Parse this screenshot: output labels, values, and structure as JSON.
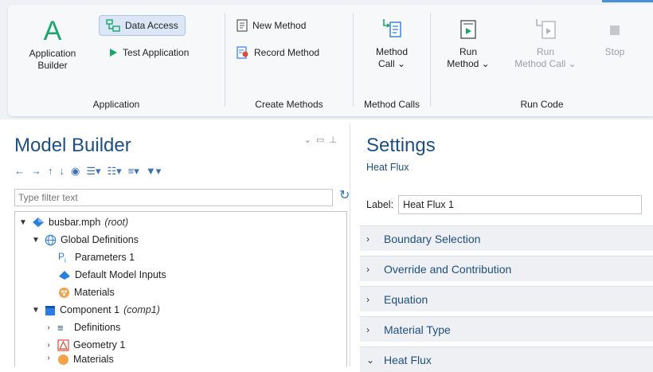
{
  "ribbon": {
    "groups": {
      "application": {
        "label": "Application",
        "app_builder": "Application\nBuilder",
        "data_access": "Data Access",
        "test_application": "Test Application"
      },
      "create_methods": {
        "label": "Create Methods",
        "new_method": "New Method",
        "record_method": "Record Method"
      },
      "method_calls": {
        "label": "Method Calls",
        "method_call": "Method\nCall ⌄"
      },
      "run_code": {
        "label": "Run Code",
        "run_method": "Run\nMethod ⌄",
        "run_method_call": "Run\nMethod Call ⌄",
        "stop": "Stop"
      }
    }
  },
  "model_builder": {
    "title": "Model Builder",
    "filter_placeholder": "Type filter text",
    "tree": {
      "root": {
        "name": "busbar.mph",
        "note": "(root)"
      },
      "global_definitions": "Global Definitions",
      "parameters": "Parameters 1",
      "default_inputs": "Default Model Inputs",
      "materials": "Materials",
      "component": {
        "name": "Component 1",
        "note": "(comp1)"
      },
      "definitions": "Definitions",
      "geometry": "Geometry 1",
      "materials_comp": "Materials"
    }
  },
  "settings": {
    "title": "Settings",
    "subtitle": "Heat Flux",
    "label_caption": "Label:",
    "label_value": "Heat Flux 1",
    "sections": [
      "Boundary Selection",
      "Override and Contribution",
      "Equation",
      "Material Type",
      "Heat Flux"
    ]
  },
  "colors": {
    "accent": "#1d4f80",
    "ribbon_bg": "#eef1f5",
    "section_bg": "#eef0f3",
    "green": "#1aa56b"
  }
}
